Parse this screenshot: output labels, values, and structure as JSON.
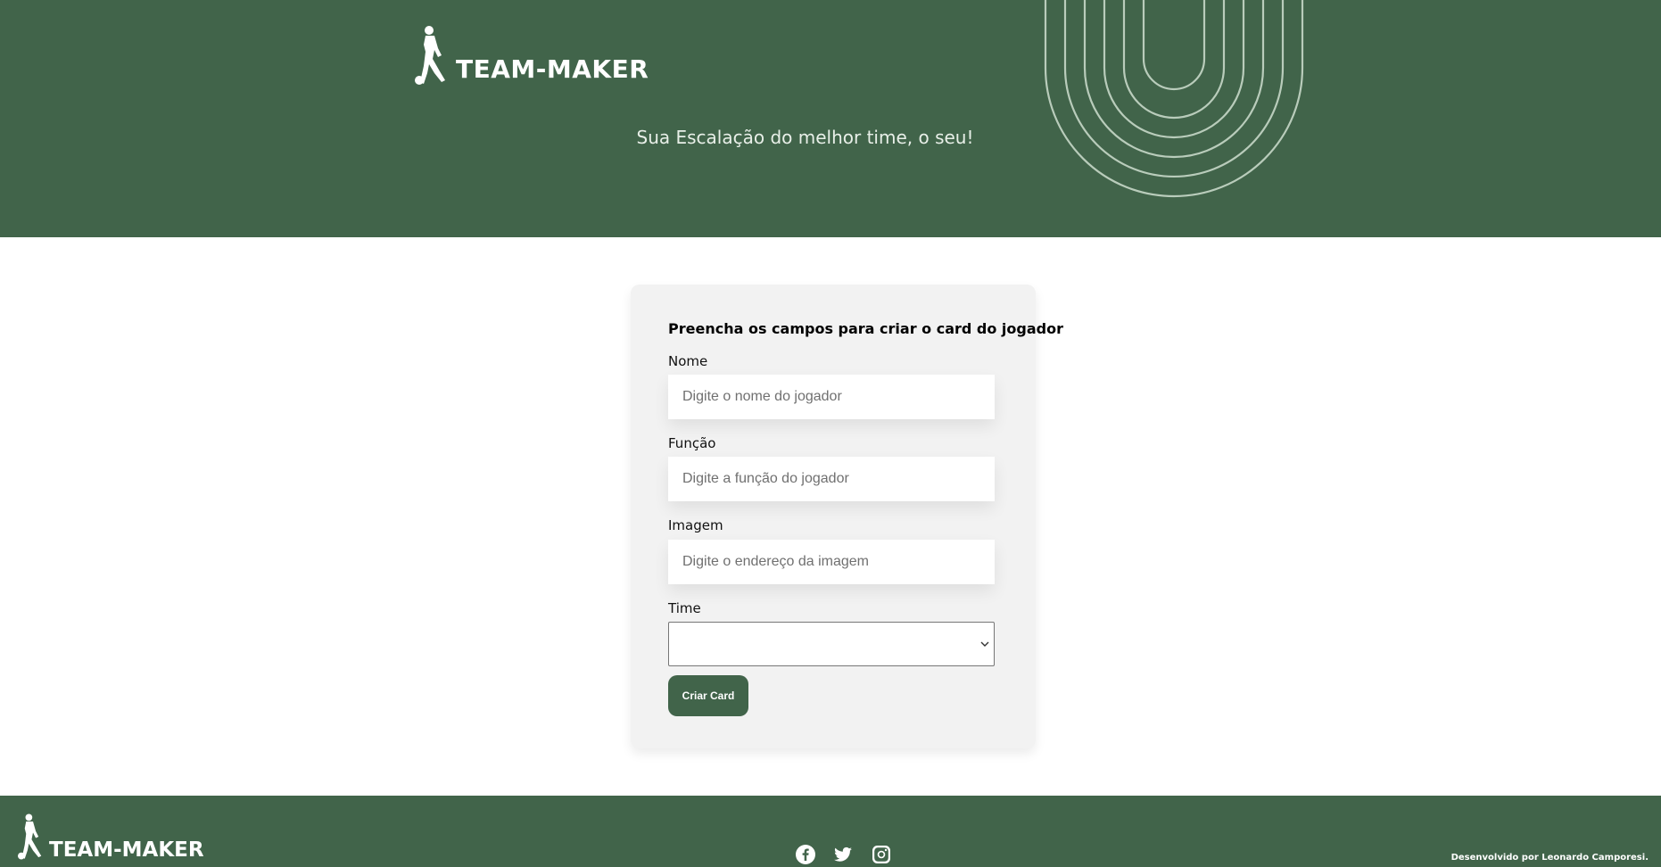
{
  "header": {
    "logo_text": "TEAM-MAKER",
    "subtitle": "Sua Escalação do melhor time, o seu!"
  },
  "form": {
    "title": "Preencha os campos para criar o card do jogador",
    "fields": [
      {
        "label": "Nome",
        "placeholder": "Digite o nome do jogador",
        "value": ""
      },
      {
        "label": "Função",
        "placeholder": "Digite a função do jogador",
        "value": ""
      },
      {
        "label": "Imagem",
        "placeholder": "Digite o endereço da imagem",
        "value": ""
      }
    ],
    "team": {
      "label": "Time",
      "selected": ""
    },
    "submit_label": "Criar Card"
  },
  "footer": {
    "logo_text": "TEAM-MAKER",
    "social_icons": [
      "facebook-icon",
      "twitter-icon",
      "instagram-icon"
    ],
    "credit": "Desenvolvido por Leonardo Camporesi."
  },
  "colors": {
    "brand_green": "#41644a",
    "card_background": "#f2f2f2",
    "white": "#ffffff"
  }
}
